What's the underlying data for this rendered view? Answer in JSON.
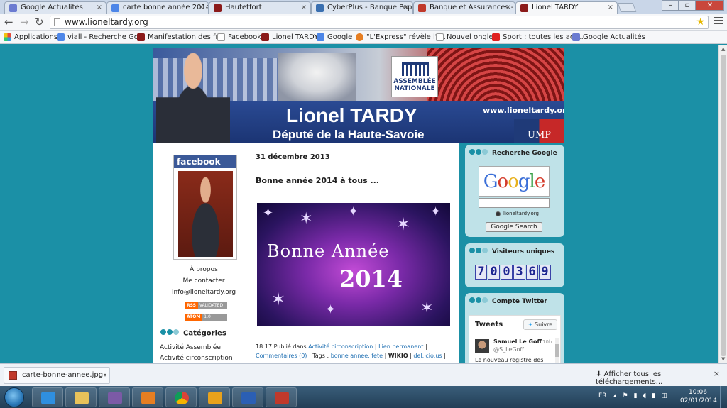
{
  "browser": {
    "tabs": [
      {
        "label": "Google Actualités",
        "color": "#6b7bd1"
      },
      {
        "label": "carte bonne année 2014 -",
        "color": "#4d86e8"
      },
      {
        "label": "Hautetfort",
        "color": "#8b1a1a"
      },
      {
        "label": "CyberPlus - Banque Popu",
        "color": "#3a6fb0"
      },
      {
        "label": "Banque et Assurances - C",
        "color": "#c0392b"
      },
      {
        "label": "Lionel TARDY",
        "color": "#8b1a1a"
      }
    ],
    "tab_close_glyph": "×",
    "url": "www.lioneltardy.org",
    "bookmarks": [
      {
        "label": "Applications",
        "color": "#e74c3c"
      },
      {
        "label": "viall - Recherche Go...",
        "color": "#4d86e8"
      },
      {
        "label": "Manifestation des fr...",
        "color": "#8b1a1a"
      },
      {
        "label": "Facebook",
        "color": "#ffffff"
      },
      {
        "label": "Lionel TARDY",
        "color": "#8b1a1a"
      },
      {
        "label": "Google",
        "color": "#4d86e8"
      },
      {
        "label": "\"L'Express\" révèle l'i...",
        "color": "#e67e22"
      },
      {
        "label": "Nouvel onglet",
        "color": "#ffffff"
      },
      {
        "label": "Sport : toutes les act...",
        "color": "#e02020"
      },
      {
        "label": "Google Actualités",
        "color": "#6b7bd1"
      }
    ]
  },
  "site": {
    "banner_name": "Lionel TARDY",
    "banner_subtitle": "Député de la Haute-Savoie",
    "banner_url": "www.lioneltardy.org",
    "an_logo": [
      "ASSEMBLÉE",
      "NATIONALE"
    ],
    "party": "UMP",
    "left": {
      "facebook": "facebook",
      "links": [
        "À propos",
        "Me contacter",
        "info@lioneltardy.org"
      ],
      "badges": [
        {
          "a": "RSS",
          "b": "VALIDATED"
        },
        {
          "a": "ATOM",
          "b": "1.0"
        }
      ],
      "categories_title": "Catégories",
      "categories": [
        "Activité Assemblée",
        "Activité circonscription"
      ]
    },
    "post": {
      "date": "31 décembre 2013",
      "title": "Bonne année 2014 à tous ...",
      "image_text_1": "Bonne Année",
      "image_text_2": "2014",
      "meta_time": "18:17 Publié dans",
      "meta_cat": "Activité circonscription",
      "meta_sep1": "|",
      "meta_perm": "Lien permanent",
      "meta_sep2": "|",
      "meta_comments": "Commentaires (0)",
      "meta_tags_label": "| Tags :",
      "meta_tags": "bonne annee, fete",
      "meta_sep3": "|",
      "meta_wikio": "WIKIO",
      "meta_sep4": "|",
      "meta_delicio": "del.icio.us",
      "meta_sep5": "|"
    },
    "right": {
      "google_title": "Recherche Google",
      "google_logo": "Google",
      "google_radio": "lioneltardy.org",
      "google_button": "Google Search",
      "visitors_title": "Visiteurs uniques",
      "visitors_digits": [
        "7",
        "0",
        "0",
        "3",
        "6",
        "9"
      ],
      "twitter_title": "Compte Twitter",
      "tweets_label": "Tweets",
      "follow_label": "Suivre",
      "tweet_name": "Samuel Le Goff",
      "tweet_time": "10h",
      "tweet_handle": "@S_LeGoff",
      "tweet_text": "Le nouveau registre des"
    }
  },
  "downloads": {
    "file": "carte-bonne-annee.jpg",
    "show_all": "Afficher tous les téléchargements...",
    "close": "×"
  },
  "taskbar": {
    "lang": "FR",
    "time": "10:06",
    "date": "02/01/2014",
    "apps": [
      {
        "name": "ie",
        "color": "#2f8fe0"
      },
      {
        "name": "explorer",
        "color": "#e8c25a"
      },
      {
        "name": "app3",
        "color": "#7b5aa6"
      },
      {
        "name": "media",
        "color": "#e67e22"
      },
      {
        "name": "chrome",
        "color": "#3fa34d"
      },
      {
        "name": "outlook",
        "color": "#e8a21c"
      },
      {
        "name": "word",
        "color": "#2b5fb4"
      },
      {
        "name": "app8",
        "color": "#c0392b"
      }
    ]
  }
}
